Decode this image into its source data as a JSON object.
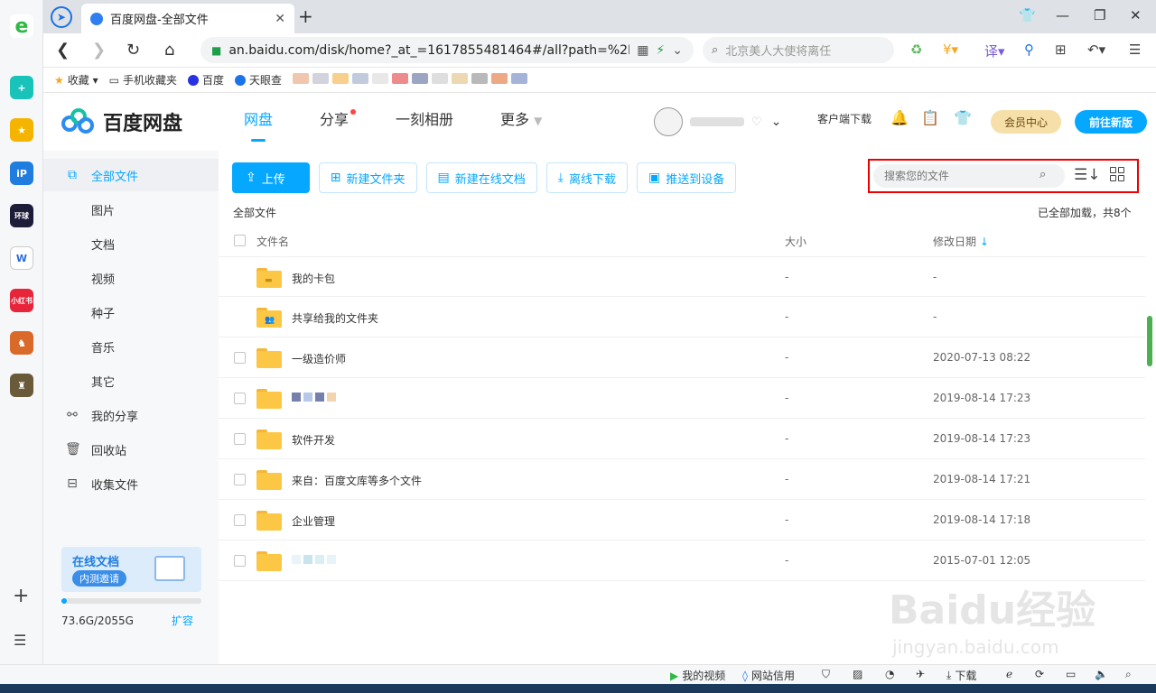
{
  "browser": {
    "tab_title": "百度网盘-全部文件",
    "url": "an.baidu.com/disk/home?_at_=1617855481464#/all?path=%2F",
    "search_placeholder": "北京美人大使将离任",
    "bookmarks": [
      {
        "label": "收藏",
        "color": "#f5a623"
      },
      {
        "label": "手机收藏夹",
        "color": "#555555"
      },
      {
        "label": "百度",
        "color": "#2932e1"
      },
      {
        "label": "天眼查",
        "color": "#1a73e8"
      }
    ]
  },
  "header": {
    "logo_text": "百度网盘",
    "nav": [
      "网盘",
      "分享",
      "一刻相册",
      "更多"
    ],
    "client_download": "客户端下载",
    "vip_center": "会员中心",
    "new_version": "前往新版"
  },
  "sidebar": {
    "items": [
      {
        "label": "全部文件",
        "icon": "files-icon"
      },
      {
        "label": "图片"
      },
      {
        "label": "文档"
      },
      {
        "label": "视频"
      },
      {
        "label": "种子"
      },
      {
        "label": "音乐"
      },
      {
        "label": "其它"
      },
      {
        "label": "我的分享",
        "icon": "share-icon"
      },
      {
        "label": "回收站",
        "icon": "trash-icon"
      },
      {
        "label": "收集文件",
        "icon": "collect-icon"
      }
    ],
    "promo_title": "在线文档",
    "promo_badge": "内测邀请",
    "quota": "73.6G/2055G",
    "quota_fraction": 0.036,
    "expand": "扩容"
  },
  "toolbar": {
    "upload": "上传",
    "new_folder": "新建文件夹",
    "new_doc": "新建在线文档",
    "offline_download": "离线下载",
    "push_device": "推送到设备",
    "search_placeholder": "搜索您的文件"
  },
  "breadcrumb": "全部文件",
  "loaded_status": "已全部加载，共8个",
  "table": {
    "columns": [
      "文件名",
      "大小",
      "修改日期"
    ],
    "rows": [
      {
        "name": "我的卡包",
        "size": "-",
        "date": "-",
        "checkbox": false
      },
      {
        "name": "共享给我的文件夹",
        "size": "-",
        "date": "-",
        "checkbox": false
      },
      {
        "name": "一级造价师",
        "size": "-",
        "date": "2020-07-13 08:22",
        "checkbox": true
      },
      {
        "name": "",
        "size": "-",
        "date": "2019-08-14 17:23",
        "checkbox": true
      },
      {
        "name": "软件开发",
        "size": "-",
        "date": "2019-08-14 17:23",
        "checkbox": true
      },
      {
        "name": "来自：百度文库等多个文件",
        "size": "-",
        "date": "2019-08-14 17:21",
        "checkbox": true
      },
      {
        "name": "企业管理",
        "size": "-",
        "date": "2019-08-14 17:18",
        "checkbox": true
      },
      {
        "name": "",
        "size": "-",
        "date": "2015-07-01 12:05",
        "checkbox": true
      }
    ]
  },
  "statusbar": {
    "my_video": "我的视频",
    "site_credit": "网站信用",
    "download": "下载"
  },
  "watermark": {
    "main": "Baidu经验",
    "sub": "jingyan.baidu.com"
  }
}
